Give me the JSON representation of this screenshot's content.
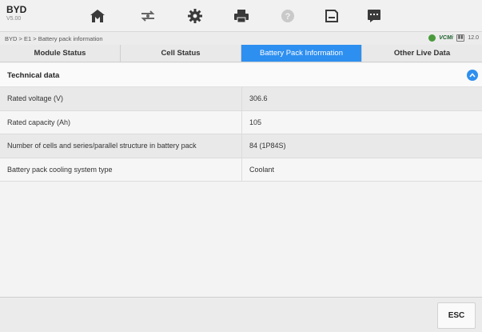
{
  "app": {
    "name": "BYD",
    "version": "V5.00"
  },
  "toolbar": {
    "icons": [
      "home-icon",
      "vehicle-swap-icon",
      "gear-icon",
      "printer-icon",
      "help-icon",
      "save-icon",
      "message-icon"
    ]
  },
  "breadcrumb": "BYD > E1 > Battery pack information",
  "status": {
    "vcm_label": "VCMi",
    "battery_readout": "12.0"
  },
  "tabs": [
    {
      "label": "Module Status",
      "active": false
    },
    {
      "label": "Cell Status",
      "active": false
    },
    {
      "label": "Battery Pack Information",
      "active": true
    },
    {
      "label": "Other Live Data",
      "active": false
    }
  ],
  "section": {
    "title": "Technical data"
  },
  "rows": [
    {
      "name": "Rated voltage (V)",
      "value": "306.6"
    },
    {
      "name": "Rated capacity (Ah)",
      "value": "105"
    },
    {
      "name": "Number of cells and series/parallel structure in battery pack",
      "value": "84 (1P84S)"
    },
    {
      "name": "Battery pack cooling system type",
      "value": "Coolant"
    }
  ],
  "footer": {
    "esc_label": "ESC"
  },
  "colors": {
    "accent": "#2d8ff0",
    "vcm_green": "#4a9a3c"
  }
}
